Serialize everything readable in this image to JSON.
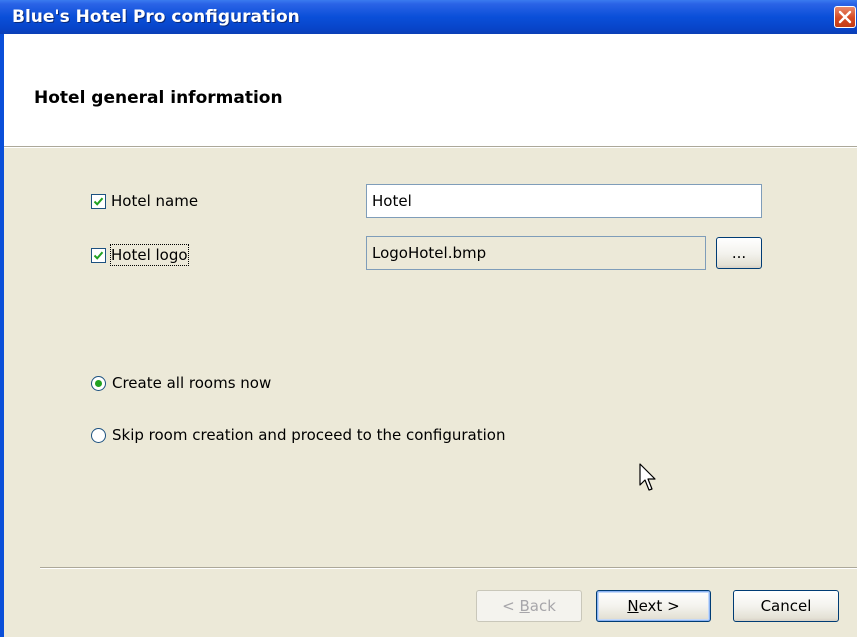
{
  "window": {
    "title": "Blue's Hotel Pro configuration"
  },
  "header": {
    "title": "Hotel general information"
  },
  "form": {
    "hotel_name": {
      "label": "Hotel name",
      "checked": true,
      "value": "Hotel"
    },
    "hotel_logo": {
      "label": "Hotel logo",
      "checked": true,
      "value": "LogoHotel.bmp",
      "browse_label": "..."
    }
  },
  "options": {
    "create_rooms": {
      "label": "Create all rooms now",
      "selected": true
    },
    "skip_rooms": {
      "label": "Skip room creation and proceed to the configuration",
      "selected": false
    }
  },
  "buttons": {
    "back": {
      "accel": "B",
      "rest": "ack",
      "prefix": "< ",
      "enabled": false
    },
    "next": {
      "accel": "N",
      "rest": "ext",
      "suffix": " >"
    },
    "cancel": {
      "label": "Cancel"
    }
  },
  "colors": {
    "titlebar": "#0a4fd9",
    "dialog_bg": "#ece9d8",
    "radio_dot": "#21a121",
    "close_button": "#d54a23"
  },
  "icons": {
    "close": "close-x-icon",
    "check": "checkmark-icon",
    "cursor": "arrow-cursor-icon"
  }
}
